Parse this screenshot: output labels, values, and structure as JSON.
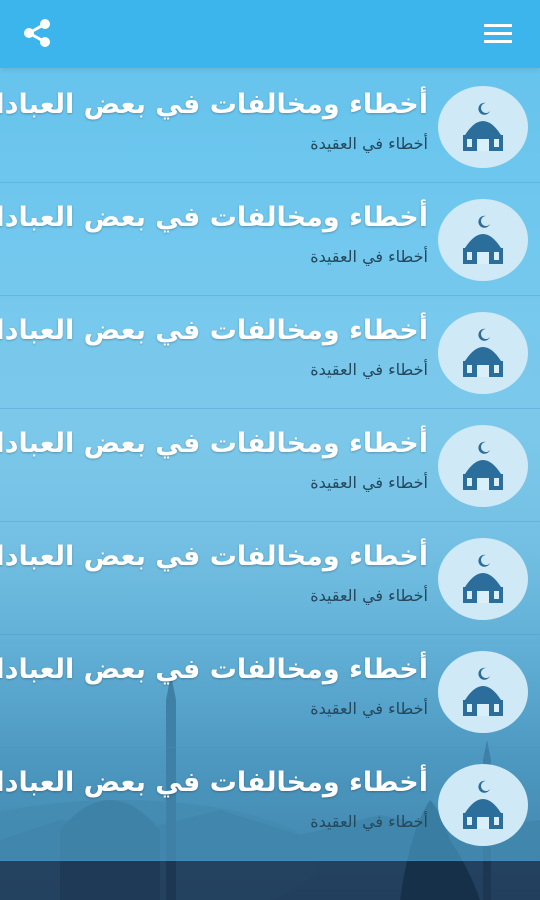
{
  "appbar": {
    "share_icon": "share-icon",
    "menu_icon": "hamburger-menu-icon",
    "color": "#3cb4ec"
  },
  "items": [
    {
      "title": "أخطاء ومخالفات في بعض العبادات",
      "subtitle": "أخطاء في العقيدة",
      "icon": "mosque-icon"
    },
    {
      "title": "أخطاء ومخالفات في بعض العبادات",
      "subtitle": "أخطاء في العقيدة",
      "icon": "mosque-icon"
    },
    {
      "title": "أخطاء ومخالفات في بعض العبادات",
      "subtitle": "أخطاء في العقيدة",
      "icon": "mosque-icon"
    },
    {
      "title": "أخطاء ومخالفات في بعض العبادات",
      "subtitle": "أخطاء في العقيدة",
      "icon": "mosque-icon"
    },
    {
      "title": "أخطاء ومخالفات في بعض العبادات",
      "subtitle": "أخطاء في العقيدة",
      "icon": "mosque-icon"
    },
    {
      "title": "أخطاء ومخالفات في بعض العبادات",
      "subtitle": "أخطاء في العقيدة",
      "icon": "mosque-icon"
    },
    {
      "title": "أخطاء ومخالفات في بعض العبادات",
      "subtitle": "أخطاء في العقيدة",
      "icon": "mosque-icon"
    }
  ]
}
